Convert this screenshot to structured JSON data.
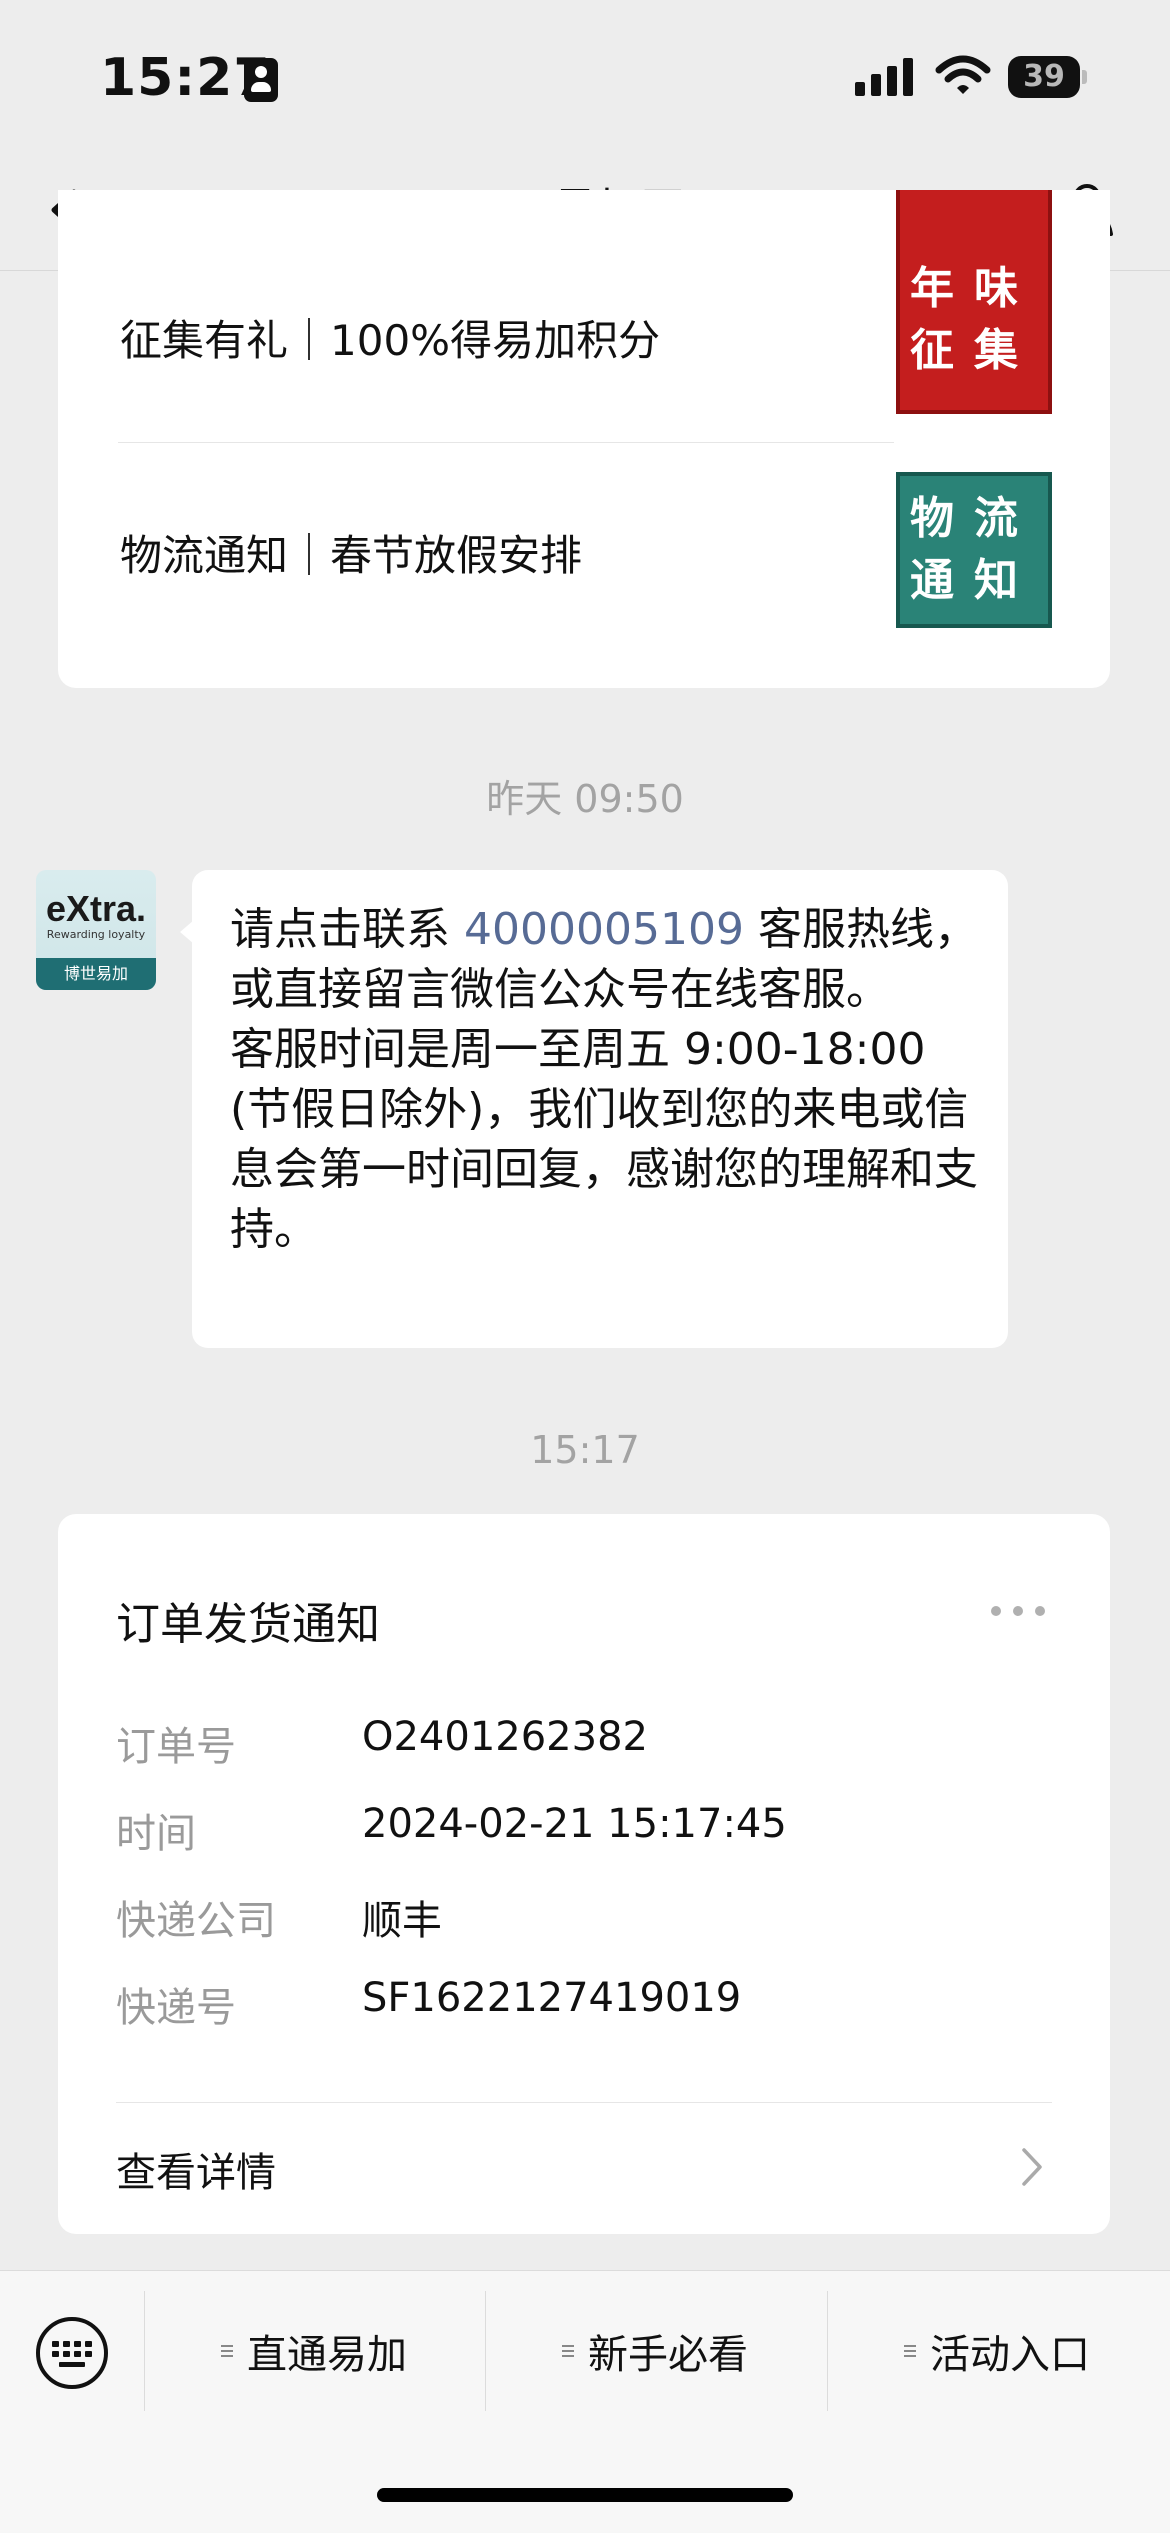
{
  "status_bar": {
    "time": "15:27",
    "battery": "39"
  },
  "nav": {
    "title": "eXtra易加网"
  },
  "articles": [
    {
      "title": "征集有礼｜100%得易加积分",
      "thumb_lines": [
        "年味",
        "征集"
      ],
      "thumb_color": "#c41e1e"
    },
    {
      "title": "物流通知｜春节放假安排",
      "thumb_lines": [
        "物流",
        "通知"
      ],
      "thumb_color": "#2a8377"
    }
  ],
  "timestamps": [
    "昨天 09:50",
    "15:17"
  ],
  "avatar": {
    "logo": "eXtra.",
    "tagline": "Rewarding loyalty",
    "band": "博世易加"
  },
  "message": {
    "prefix": "请点击联系 ",
    "phone": "4000005109",
    "body": " 客服热线，或直接留言微信公众号在线客服。\n客服时间是周一至周五 9:00-18:00 (节假日除外)，我们收到您的来电或信息会第一时间回复，感谢您的理解和支持。"
  },
  "order_card": {
    "title": "订单发货通知",
    "rows": [
      {
        "label": "订单号",
        "value": "O2401262382"
      },
      {
        "label": "时间",
        "value": "2024-02-21 15:17:45"
      },
      {
        "label": "快递公司",
        "value": "顺丰"
      },
      {
        "label": "快递号",
        "value": "SF1622127419019"
      }
    ],
    "details_label": "查看详情"
  },
  "menu": [
    "直通易加",
    "新手必看",
    "活动入口"
  ],
  "colors": {
    "link": "#576b95",
    "background": "#ededed"
  }
}
